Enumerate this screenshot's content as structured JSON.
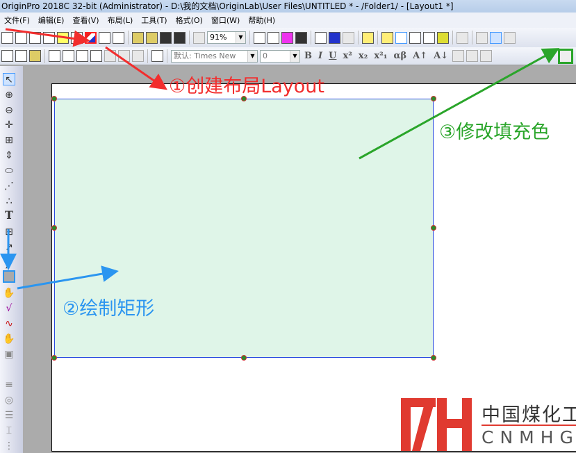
{
  "window": {
    "title": "OriginPro 2018C 32-bit (Administrator) - D:\\我的文档\\OriginLab\\User Files\\UNTITLED * - /Folder1/ - [Layout1 *]"
  },
  "menu": [
    "文件(F)",
    "编辑(E)",
    "查看(V)",
    "布局(L)",
    "工具(T)",
    "格式(O)",
    "窗口(W)",
    "帮助(H)"
  ],
  "toolbar": {
    "zoom": "91%",
    "font": "默认: Times New",
    "size": "0",
    "dropdown_glyph": "▼"
  },
  "format_buttons": [
    "B",
    "I",
    "U",
    "x²",
    "x₂",
    "x²₁",
    "αβ",
    "A↑",
    "A↓"
  ],
  "toolbox": {
    "text_tool": "T"
  },
  "annotations": {
    "step1": "①创建布局Layout",
    "step2": "②绘制矩形",
    "step3": "③修改填充色"
  },
  "colors": {
    "rect_fill": "#dff5e8",
    "rect_border": "#2a4be0",
    "red": "#f22d2d",
    "green": "#2aa52a",
    "blue": "#2b95f0"
  },
  "watermark": {
    "cn": "中国煤化工",
    "en": "CNMHG",
    "mark": "MH"
  }
}
